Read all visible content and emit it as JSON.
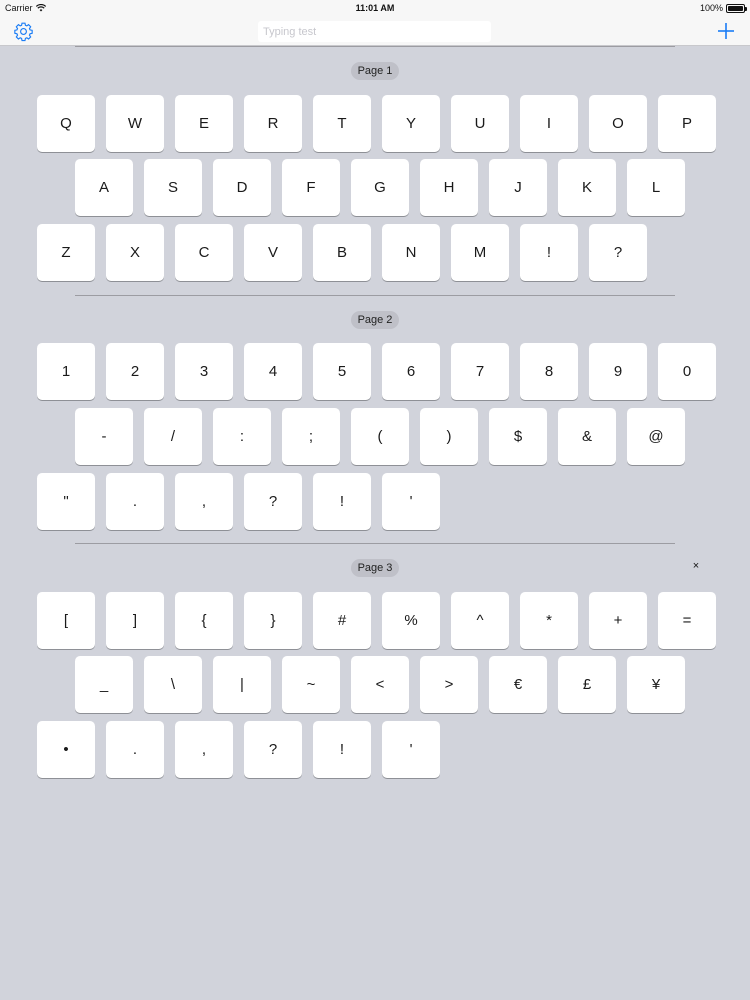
{
  "status_bar": {
    "carrier": "Carrier",
    "time": "11:01 AM",
    "battery": "100%"
  },
  "nav": {
    "search_placeholder": "Typing test",
    "search_value": ""
  },
  "pages": [
    {
      "label": "Page 1",
      "rows": [
        [
          "Q",
          "W",
          "E",
          "R",
          "T",
          "Y",
          "U",
          "I",
          "O",
          "P"
        ],
        [
          "A",
          "S",
          "D",
          "F",
          "G",
          "H",
          "J",
          "K",
          "L"
        ],
        [
          "Z",
          "X",
          "C",
          "V",
          "B",
          "N",
          "M",
          "!",
          "?"
        ]
      ]
    },
    {
      "label": "Page 2",
      "rows": [
        [
          "1",
          "2",
          "3",
          "4",
          "5",
          "6",
          "7",
          "8",
          "9",
          "0"
        ],
        [
          "-",
          "/",
          ":",
          ";",
          "(",
          ")",
          "$",
          "&",
          "@"
        ],
        [
          "\"",
          ".",
          ",",
          "?",
          "!",
          "'"
        ]
      ]
    },
    {
      "label": "Page 3",
      "close_label": "×",
      "rows": [
        [
          "[",
          "]",
          "{",
          "}",
          "#",
          "%",
          "^",
          "*",
          "+",
          "="
        ],
        [
          "_",
          "\\",
          "|",
          "~",
          "<",
          ">",
          "€",
          "£",
          "¥"
        ],
        [
          "•",
          ".",
          ",",
          "?",
          "!",
          "'"
        ]
      ]
    }
  ],
  "colors": {
    "accent": "#1a7cf5",
    "background": "#d1d3db",
    "key": "#ffffff"
  },
  "icons": {
    "settings": "gear-icon",
    "add": "plus-icon",
    "wifi": "wifi-icon",
    "battery": "battery-icon"
  }
}
